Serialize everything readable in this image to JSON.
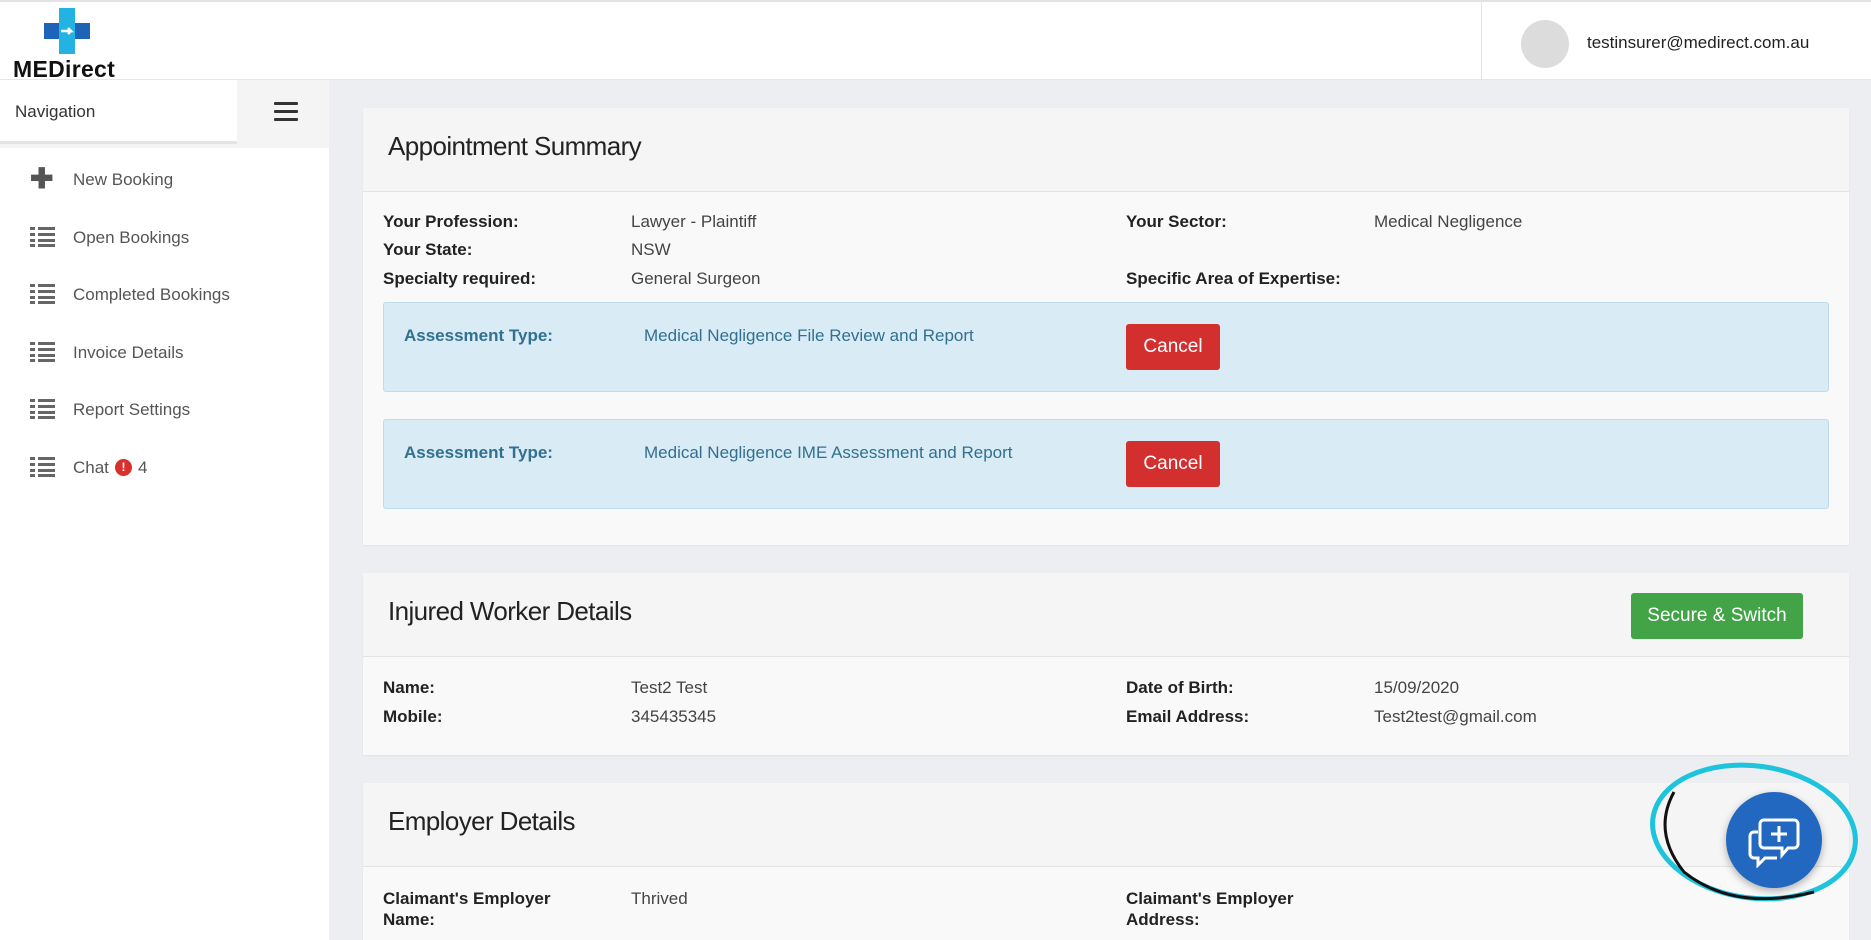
{
  "brand": {
    "name": "MEDirect"
  },
  "user": {
    "email": "testinsurer@medirect.com.au"
  },
  "sidebar": {
    "header": "Navigation",
    "items": [
      {
        "label": "New Booking",
        "icon": "plus-icon"
      },
      {
        "label": "Open Bookings",
        "icon": "list-icon"
      },
      {
        "label": "Completed Bookings",
        "icon": "list-icon"
      },
      {
        "label": "Invoice Details",
        "icon": "list-icon"
      },
      {
        "label": "Report Settings",
        "icon": "list-icon"
      },
      {
        "label": "Chat",
        "icon": "list-icon",
        "badge": "!",
        "count": "4"
      }
    ]
  },
  "appointment": {
    "title": "Appointment Summary",
    "fields": {
      "profession_label": "Your Profession:",
      "profession": "Lawyer - Plaintiff",
      "state_label": "Your State:",
      "state": "NSW",
      "specialty_label": "Specialty required:",
      "specialty": "General Surgeon",
      "sector_label": "Your Sector:",
      "sector": "Medical Negligence",
      "expertise_label": "Specific Area of Expertise:",
      "expertise": ""
    },
    "assessments": [
      {
        "label": "Assessment Type:",
        "value": "Medical Negligence File Review and Report",
        "button": "Cancel"
      },
      {
        "label": "Assessment Type:",
        "value": "Medical Negligence IME Assessment and Report",
        "button": "Cancel"
      }
    ]
  },
  "worker": {
    "title": "Injured Worker Details",
    "button": "Secure & Switch",
    "name_label": "Name:",
    "name": "Test2 Test",
    "mobile_label": "Mobile:",
    "mobile": "345435345",
    "dob_label": "Date of Birth:",
    "dob": "15/09/2020",
    "email_label": "Email Address:",
    "email": "Test2test@gmail.com"
  },
  "employer": {
    "title": "Employer Details",
    "name_label_1": "Claimant's Employer",
    "name_label_2": "Name:",
    "name": "Thrived",
    "address_label_1": "Claimant's Employer",
    "address_label_2": "Address:",
    "address": ""
  },
  "colors": {
    "primary_blue": "#2368c0",
    "cancel_red": "#d32f2f",
    "success_green": "#43a347",
    "info_bg": "#d9ebf5",
    "info_text": "#31708f",
    "highlight_ring": "#1ec3dc"
  }
}
